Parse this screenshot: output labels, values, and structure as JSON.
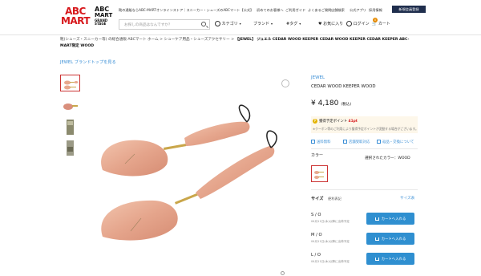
{
  "header": {
    "logo_line1": "ABC",
    "logo_line2": "MART",
    "grand_stage_line1": "ABC",
    "grand_stage_line2": "MART",
    "grand_stage_line3": "GRAND STAGE",
    "tagline": "靴の通販ならABC-MARTオンラインストア｜スニーカー・シューズのABCマート【公式】",
    "utility_links": [
      "初めてのお客様へ",
      "ご利用ガイド",
      "よくあるご質問",
      "店舗検索",
      "公式アプリ",
      "採用情報"
    ],
    "member_button": "新規会員登録",
    "search_placeholder": "お探しの商品はなんですか？",
    "nav": {
      "category": "カテゴリ",
      "brand": "ブランド",
      "tag": "#タグ",
      "favorites": "お気に入り",
      "login": "ログイン",
      "cart": "カート",
      "cart_count": "0"
    }
  },
  "breadcrumb": {
    "items": [
      "靴(シューズ・スニーカー等) の総合通販 ABCマート ホーム",
      "シューケア用品・シューズアクセサリー"
    ],
    "current": "【JEWEL】 ジュエル CEDAR WOOD KEEPER CEDAR WOOD KEEPER CEDAR KEEPER ABC-MART限定 WOOD",
    "separator": ">"
  },
  "brand_top_link": "JEWEL ブランドトップを見る",
  "product": {
    "brand": "JEWEL",
    "name": "CEDAR WOOD KEEPER WOOD",
    "price": "¥ 4,180",
    "tax_label": "(税込)",
    "points_label": "獲得予定ポイント",
    "points_value": "41pt",
    "points_note": "※クーポン等のご利用により獲得予定ポイントが変動する場合がございます。",
    "info_links": [
      "送料無料",
      "店舗受取対応",
      "返品・交換について"
    ],
    "color_label": "カラー",
    "selected_color_label": "選択されたカラー：WOOD",
    "size_label": "サイズ",
    "size_note": "便利表記",
    "size_guide": "サイズ表",
    "sizes": [
      {
        "name": "S / O",
        "ship": "04月11日(木)以降に出荷予定",
        "button": "カートへ入れる"
      },
      {
        "name": "M / O",
        "ship": "04月11日(木)以降に出荷予定",
        "button": "カートへ入れる"
      },
      {
        "name": "L / O",
        "ship": "04月11日(木)以降に出荷予定",
        "button": "カートへ入れる"
      }
    ]
  },
  "colors": {
    "brand_red": "#d7181c",
    "accent_blue": "#2f8fd0",
    "link_blue": "#3b8fd6",
    "navy": "#1f2e4d"
  }
}
